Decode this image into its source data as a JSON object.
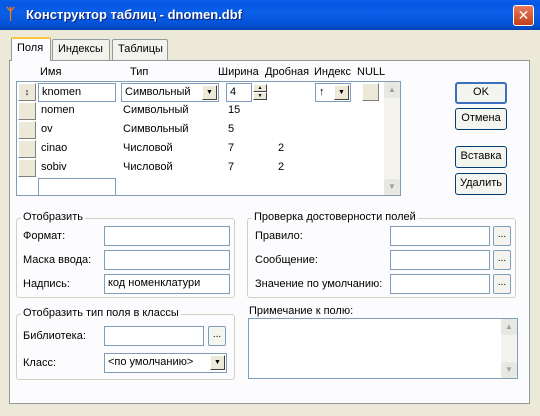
{
  "window": {
    "title": "Конструктор таблиц - dnomen.dbf",
    "close_label": "✕",
    "app_icon": "fox-icon"
  },
  "tabs": [
    "Поля",
    "Индексы",
    "Таблицы"
  ],
  "grid": {
    "columns": [
      "Имя",
      "Тип",
      "Ширина",
      "Дробная",
      "Индекс",
      "NULL"
    ],
    "rows": [
      {
        "name": "knomen",
        "type": "Символьный",
        "width": "4",
        "decimals": "",
        "index": "↑",
        "marker": "↕"
      },
      {
        "name": "nomen",
        "type": "Символьный",
        "width": "15",
        "decimals": ""
      },
      {
        "name": "ov",
        "type": "Символьный",
        "width": "5",
        "decimals": ""
      },
      {
        "name": "cinao",
        "type": "Числовой",
        "width": "7",
        "decimals": "2"
      },
      {
        "name": "sobiv",
        "type": "Числовой",
        "width": "7",
        "decimals": "2"
      }
    ],
    "new_row_value": ""
  },
  "buttons": {
    "ok": "OK",
    "cancel": "Отмена",
    "insert": "Вставка",
    "delete": "Удалить"
  },
  "display": {
    "title": "Отобразить",
    "format_label": "Формат:",
    "format_value": "",
    "mask_label": "Маска ввода:",
    "mask_value": "",
    "caption_label": "Надпись:",
    "caption_value": "код номенклатури"
  },
  "validation": {
    "title": "Проверка достоверности полей",
    "rule_label": "Правило:",
    "rule_value": "",
    "message_label": "Сообщение:",
    "message_value": "",
    "default_label": "Значение по умолчанию:",
    "default_value": "",
    "dots": "..."
  },
  "classes": {
    "title": "Отобразить тип поля в классы",
    "library_label": "Библиотека:",
    "library_value": "",
    "class_label": "Класс:",
    "class_value": "<по умолчанию>"
  },
  "comment": {
    "label": "Примечание к полю:",
    "value": ""
  }
}
